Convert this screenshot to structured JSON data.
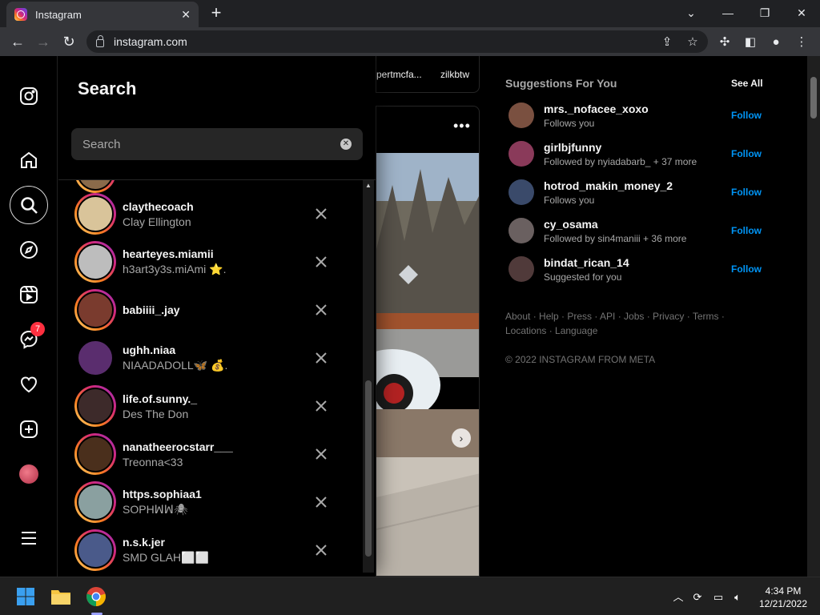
{
  "browser": {
    "tab_title": "Instagram",
    "url": "instagram.com"
  },
  "nav": {
    "messages_badge": "7"
  },
  "search_panel": {
    "heading": "Search",
    "placeholder": "Search",
    "recent": [
      {
        "username": "claythecoach",
        "subtitle": "Clay Ellington",
        "ring": true,
        "color": "#d9c49a"
      },
      {
        "username": "hearteyes.miamii",
        "subtitle": "h3art3y3s.miAmi ⭐.",
        "ring": true,
        "color": "#bdbdbd"
      },
      {
        "username": "babiiii_.jay",
        "subtitle": "",
        "ring": true,
        "color": "#7a3b2e"
      },
      {
        "username": "ughh.niaa",
        "subtitle": "NIAADADOLL🦋 💰.",
        "ring": false,
        "color": "#5a2d6e"
      },
      {
        "username": "life.of.sunny._",
        "subtitle": "Des The Don",
        "ring": true,
        "color": "#3d2a2a"
      },
      {
        "username": "nanatheerocstarr___",
        "subtitle": "Treonna<33",
        "ring": true,
        "color": "#4a2f1c"
      },
      {
        "username": "https.sophiaa1",
        "subtitle": "SOPHꟽꟽ🕷",
        "ring": true,
        "color": "#8aa0a0"
      },
      {
        "username": "n.s.k.jer",
        "subtitle": "SMD GLAH⬜⬜",
        "ring": true,
        "color": "#4a5a8a"
      }
    ]
  },
  "feed": {
    "stories": [
      "pertmcfa...",
      "zilkbtw"
    ]
  },
  "suggestions": {
    "title": "Suggestions For You",
    "see_all": "See All",
    "items": [
      {
        "username": "mrs._nofacee_xoxo",
        "reason": "Follows you",
        "action": "Follow",
        "color": "#7a5040"
      },
      {
        "username": "girlbjfunny",
        "reason": "Followed by nyiadabarb_ + 37 more",
        "action": "Follow",
        "color": "#8a3a5a"
      },
      {
        "username": "hotrod_makin_money_2",
        "reason": "Follows you",
        "action": "Follow",
        "color": "#3a4a6a"
      },
      {
        "username": "cy_osama",
        "reason": "Followed by sin4maniii + 36 more",
        "action": "Follow",
        "color": "#6a6060"
      },
      {
        "username": "bindat_rican_14",
        "reason": "Suggested for you",
        "action": "Follow",
        "color": "#503a3a"
      }
    ],
    "footer_links": "About · Help · Press · API · Jobs · Privacy · Terms · Locations · Language",
    "copyright": "© 2022 INSTAGRAM FROM META"
  },
  "taskbar": {
    "time": "4:34 PM",
    "date": "12/21/2022"
  }
}
